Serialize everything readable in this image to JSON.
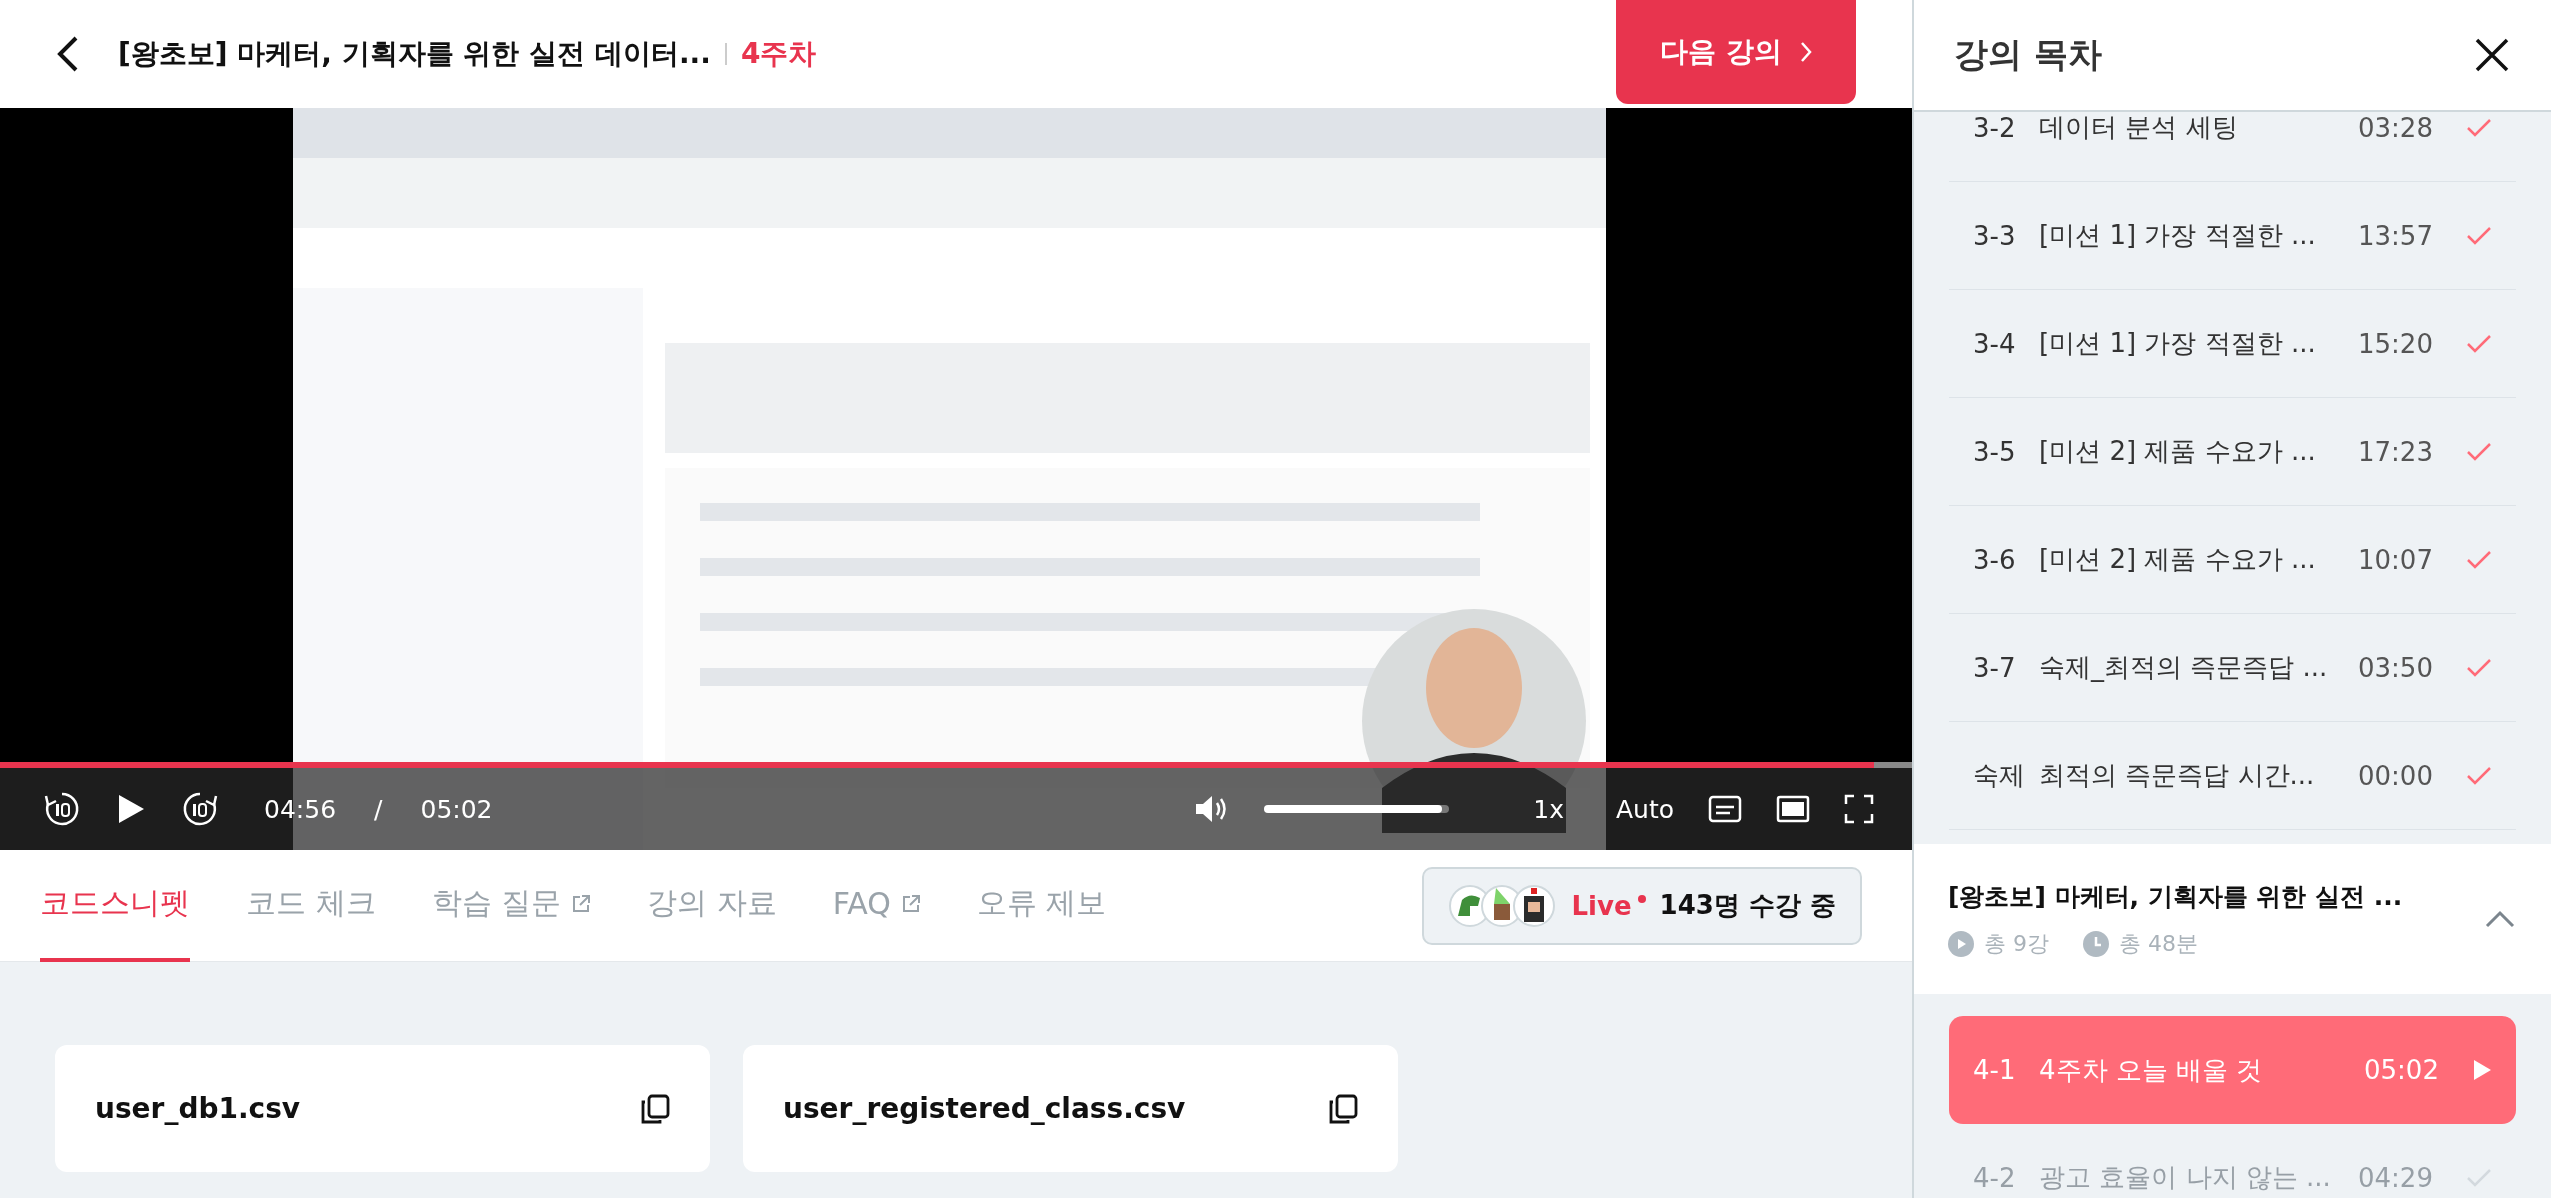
{
  "header": {
    "title": "[왕초보] 마케터, 기획자를 위한 실전 데이터...",
    "week": "4주차",
    "next_button": "다음 강의"
  },
  "player": {
    "progress": {
      "level": 0.98
    },
    "current_time": "04:56",
    "separator": "/",
    "duration": "05:02",
    "volume": {
      "level": 0.96
    },
    "speed": "1x",
    "quality": "Auto"
  },
  "tabs": [
    {
      "label": "코드스니펫",
      "selected": true,
      "external": false
    },
    {
      "label": "코드 체크",
      "selected": false,
      "external": false
    },
    {
      "label": "학습 질문",
      "selected": false,
      "external": true
    },
    {
      "label": "강의 자료",
      "selected": false,
      "external": false
    },
    {
      "label": "FAQ",
      "selected": false,
      "external": true
    },
    {
      "label": "오류 제보",
      "selected": false,
      "external": false
    }
  ],
  "live": {
    "label": "Live",
    "viewers": "143명 수강 중"
  },
  "snippets": [
    {
      "name": "user_db1.csv"
    },
    {
      "name": "user_registered_class.csv"
    }
  ],
  "sidebar": {
    "title": "강의 목차",
    "lessons": [
      {
        "number": "3-2",
        "title": "데이터 분석 세팅",
        "duration": "03:28",
        "selected": false,
        "disabled": false
      },
      {
        "number": "3-3",
        "title": "[미션 1] 가장 적절한 ...",
        "duration": "13:57",
        "selected": false,
        "disabled": false
      },
      {
        "number": "3-4",
        "title": "[미션 1] 가장 적절한 ...",
        "duration": "15:20",
        "selected": false,
        "disabled": false
      },
      {
        "number": "3-5",
        "title": "[미션 2] 제품 수요가 ...",
        "duration": "17:23",
        "selected": false,
        "disabled": false
      },
      {
        "number": "3-6",
        "title": "[미션 2] 제품 수요가 ...",
        "duration": "10:07",
        "selected": false,
        "disabled": false
      },
      {
        "number": "3-7",
        "title": "숙제_최적의 즉문즉답 ...",
        "duration": "03:50",
        "selected": false,
        "disabled": false
      },
      {
        "number": "숙제",
        "title": "최적의 즉문즉답 시간...",
        "duration": "00:00",
        "selected": false,
        "disabled": false
      }
    ],
    "section": {
      "title": "[왕초보] 마케터, 기획자를 위한 실전 ...",
      "expanded": true,
      "lesson_count": "총 9강",
      "total_time": "총 48분",
      "lessons": [
        {
          "number": "4-1",
          "title": "4주차 오늘 배울 것",
          "duration": "05:02",
          "selected": true,
          "disabled": false
        },
        {
          "number": "4-2",
          "title": "광고 효율이 나지 않는 ...",
          "duration": "04:29",
          "selected": false,
          "disabled": true
        }
      ]
    }
  }
}
